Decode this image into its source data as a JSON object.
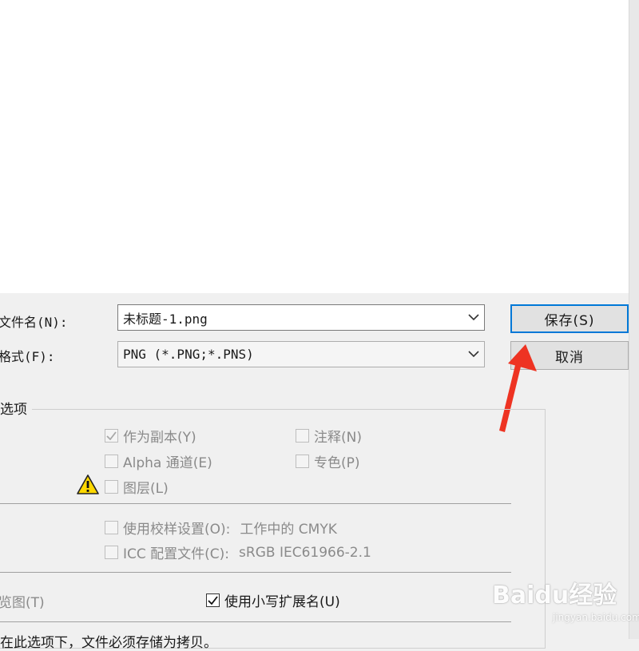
{
  "file_area": {},
  "filename": {
    "label": "文件名(N):",
    "value": "未标题-1.png"
  },
  "format": {
    "label": "格式(F):",
    "value": "PNG (*.PNG;*.PNS)"
  },
  "buttons": {
    "save": "保存(S)",
    "cancel": "取消"
  },
  "save_options": {
    "title": "选项",
    "as_copy": {
      "label": "作为副本(Y)",
      "checked": true,
      "enabled": false
    },
    "notes": {
      "label": "注释(N)",
      "checked": false,
      "enabled": false
    },
    "alpha": {
      "label": "Alpha 通道(E)",
      "checked": false,
      "enabled": false
    },
    "spot": {
      "label": "专色(P)",
      "checked": false,
      "enabled": false
    },
    "layers": {
      "label": "图层(L)",
      "checked": false,
      "enabled": false
    },
    "proof": {
      "label": "使用校样设置(O):",
      "value": "工作中的 CMYK",
      "checked": false,
      "enabled": false
    },
    "icc": {
      "label": "ICC 配置文件(C):",
      "value": "sRGB IEC61966-2.1",
      "checked": false,
      "enabled": false
    }
  },
  "thumbnail": {
    "label": "览图(T)"
  },
  "lowercase_ext": {
    "label": "使用小写扩展名(U)",
    "checked": true
  },
  "warning_text": "在此选项下，文件必须存储为拷贝。",
  "watermark": {
    "brand": "Baidu经验",
    "sub": "jingyan.baidu.com"
  },
  "colors": {
    "accent": "#0078d7",
    "arrow": "#ee3322",
    "warning": "#ffd800"
  }
}
